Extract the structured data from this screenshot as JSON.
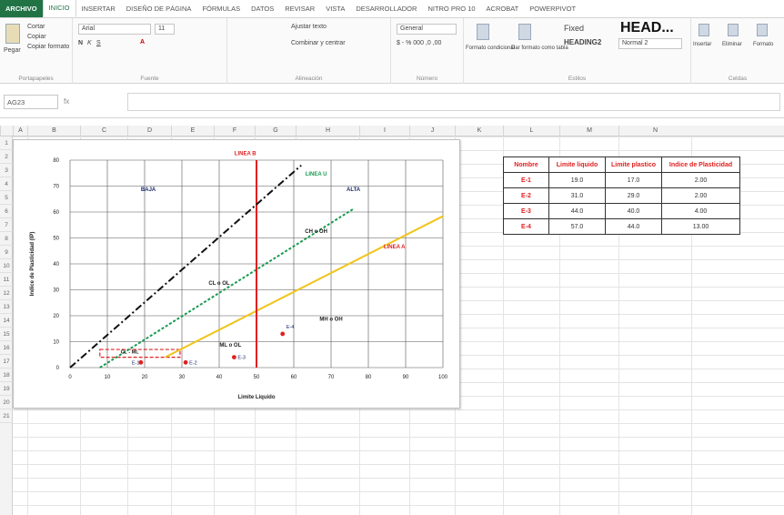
{
  "tabs": [
    {
      "label": "ARCHIVO"
    },
    {
      "label": "INICIO"
    },
    {
      "label": "INSERTAR"
    },
    {
      "label": "DISEÑO DE PÁGINA"
    },
    {
      "label": "FÓRMULAS"
    },
    {
      "label": "DATOS"
    },
    {
      "label": "REVISAR"
    },
    {
      "label": "VISTA"
    },
    {
      "label": "DESARROLLADOR"
    },
    {
      "label": "NITRO PRO 10"
    },
    {
      "label": "ACROBAT"
    },
    {
      "label": "POWERPIVOT"
    }
  ],
  "ribbon": {
    "paste_label": "Pegar",
    "cut_label": "Cortar",
    "copy_label": "Copiar",
    "format_painter_label": "Copiar formato",
    "clipboard_group": "Portapapeles",
    "font_name": "Arial",
    "font_size": "11",
    "font_group": "Fuente",
    "wrap_text_label": "Ajustar texto",
    "merge_label": "Combinar y centrar",
    "alignment_group": "Alineación",
    "number_format": "General",
    "number_group": "Número",
    "conditional_format_label": "Formato condicional",
    "format_table_label": "Dar formato como tabla",
    "styles": {
      "fixed": "Fixed",
      "heading": "HEAD...",
      "heading2": "HEADING2",
      "normal2": "Normal 2"
    },
    "styles_group": "Estilos",
    "insert_label": "Insertar",
    "delete_label": "Eliminar",
    "format_label": "Formato",
    "cells_group": "Celdas"
  },
  "formula_bar": {
    "name_box": "AG23",
    "fx": "fx",
    "value": ""
  },
  "columns": [
    "A",
    "B",
    "C",
    "D",
    "E",
    "F",
    "G",
    "H",
    "I",
    "J",
    "K",
    "L",
    "M",
    "N"
  ],
  "rows": [
    "1",
    "2",
    "3",
    "4",
    "5",
    "6",
    "7",
    "8",
    "9",
    "10",
    "11",
    "12",
    "13",
    "14",
    "15",
    "16",
    "17",
    "18",
    "19",
    "20",
    "21"
  ],
  "table": {
    "headers": [
      "Nombre",
      "Limite liquido",
      "Limite plastico",
      "Indice de Plasticidad"
    ],
    "rows": [
      [
        "E-1",
        "19.0",
        "17.0",
        "2.00"
      ],
      [
        "E-2",
        "31.0",
        "29.0",
        "2.00"
      ],
      [
        "E-3",
        "44.0",
        "40.0",
        "4.00"
      ],
      [
        "E-4",
        "57.0",
        "44.0",
        "13.00"
      ]
    ]
  },
  "colors": {
    "excel_green": "#217346",
    "red": "#e02020",
    "linea_a": "#f0c419",
    "linea_u": "#1a9a50",
    "linea_b": "#e02020"
  },
  "chart_data": {
    "type": "scatter",
    "title": "",
    "xlabel": "Limite Liquido",
    "ylabel": "Indice de Plasticidad (IP)",
    "xlim": [
      0,
      100
    ],
    "ylim": [
      0,
      80
    ],
    "xticks": [
      0,
      10,
      20,
      30,
      40,
      50,
      60,
      70,
      80,
      90,
      100
    ],
    "yticks": [
      0,
      10,
      20,
      30,
      40,
      50,
      60,
      70,
      80
    ],
    "series": [
      {
        "name": "E-1",
        "values": [
          {
            "x": 19,
            "y": 2
          }
        ]
      },
      {
        "name": "E-2",
        "values": [
          {
            "x": 31,
            "y": 2
          }
        ]
      },
      {
        "name": "E-3",
        "values": [
          {
            "x": 44,
            "y": 4
          }
        ]
      },
      {
        "name": "E-4",
        "values": [
          {
            "x": 57,
            "y": 13
          }
        ]
      }
    ],
    "lines": [
      {
        "name": "LINEA A",
        "points": [
          [
            25.5,
            4
          ],
          [
            100,
            58.4
          ]
        ],
        "style": "solid",
        "color": "#f0c419"
      },
      {
        "name": "LINEA U",
        "points": [
          [
            8,
            0
          ],
          [
            76,
            61.2
          ]
        ],
        "style": "dotted",
        "color": "#1a9a50"
      },
      {
        "name": "LINEA B",
        "points": [
          [
            50,
            0
          ],
          [
            50,
            80
          ]
        ],
        "style": "solid",
        "color": "#e02020"
      },
      {
        "name": "",
        "points": [
          [
            0,
            0
          ],
          [
            62,
            78
          ]
        ],
        "style": "dashdot",
        "color": "#111111"
      }
    ],
    "zone_labels": [
      {
        "text": "BAJA",
        "x": 21,
        "y": 68
      },
      {
        "text": "ALTA",
        "x": 76,
        "y": 68
      },
      {
        "text": "CH  o  OH",
        "x": 66,
        "y": 52
      },
      {
        "text": "CL  o  OL",
        "x": 40,
        "y": 32
      },
      {
        "text": "MH  o  OH",
        "x": 70,
        "y": 18
      },
      {
        "text": "ML  o  OL",
        "x": 43,
        "y": 8
      },
      {
        "text": "CL - ML",
        "x": 16,
        "y": 5.5
      }
    ],
    "line_labels": [
      {
        "text": "LINEA B",
        "x": 47,
        "y": 82
      },
      {
        "text": "LINEA U",
        "x": 66,
        "y": 74
      },
      {
        "text": "LINEA A",
        "x": 87,
        "y": 46
      }
    ],
    "point_labels": [
      "E-1",
      "E-2",
      "E-3",
      "E-4"
    ],
    "clml_box": {
      "xmin": 8,
      "xmax": 29.5,
      "ymin": 4,
      "ymax": 7
    }
  }
}
